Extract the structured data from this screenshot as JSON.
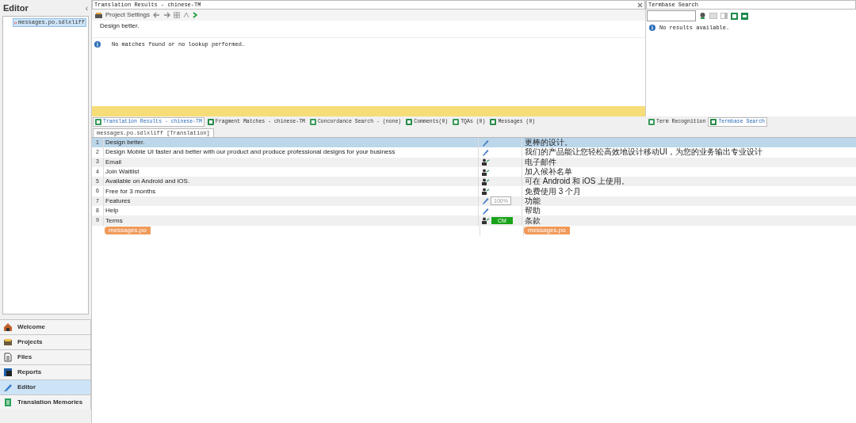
{
  "sidebar": {
    "title": "Editor",
    "collapse": "‹",
    "files": [
      {
        "name": "messages.po.sdlxliff",
        "selected": true
      }
    ],
    "nav": [
      {
        "label": "Welcome",
        "kind": "home",
        "selected": false
      },
      {
        "label": "Projects",
        "kind": "folder",
        "selected": false
      },
      {
        "label": "Files",
        "kind": "file",
        "selected": false
      },
      {
        "label": "Reports",
        "kind": "report",
        "selected": false
      },
      {
        "label": "Editor",
        "kind": "pencil",
        "selected": true
      },
      {
        "label": "Translation Memories",
        "kind": "tm",
        "selected": false
      }
    ]
  },
  "results_panel": {
    "title": "Translation Results - chinese-TM",
    "toolbar_label": "Project Settings",
    "source": "Design better.",
    "message": "No matches found or no lookup performed."
  },
  "termbase_panel": {
    "title": "Termbase Search",
    "message": "No results available."
  },
  "bottom_tabs": [
    {
      "label": "Translation Results - chinese-TM",
      "selected": true
    },
    {
      "label": "Fragment Matches - chinese-TM",
      "selected": false
    },
    {
      "label": "Concordance Search - (none)",
      "selected": false
    },
    {
      "label": "Comments(0)",
      "selected": false
    },
    {
      "label": "TQAs (0)",
      "selected": false
    },
    {
      "label": "Messages (0)",
      "selected": false
    }
  ],
  "right_tabs": [
    {
      "label": "Term Recognition",
      "selected": false
    },
    {
      "label": "Termbase Search",
      "selected": true
    }
  ],
  "document_tab": "messages.po.sdlxliff [Translation]",
  "segments": [
    {
      "number": "1",
      "source": "Design better.",
      "kind": "edited",
      "target": "更棒的设计。",
      "selected": true
    },
    {
      "number": "2",
      "source": "Design Mobile UI faster and better with our product and produce professional designs for your business",
      "kind": "edited",
      "target": "我们的产品能让您轻松高效地设计移动UI，为您的业务输出专业设计",
      "selected": false
    },
    {
      "number": "3",
      "source": "Email",
      "kind": "translated",
      "target": "电子邮件",
      "selected": false
    },
    {
      "number": "4",
      "source": "Join Waitlist",
      "kind": "translated",
      "target": "加入候补名单",
      "selected": false
    },
    {
      "number": "5",
      "source": "Available on Android and iOS.",
      "kind": "translated",
      "target": "可在 Android 和 iOS 上使用。",
      "selected": false
    },
    {
      "number": "6",
      "source": "Free for 3 months",
      "kind": "translated",
      "target": "免费使用 3 个月",
      "selected": false
    },
    {
      "number": "7",
      "source": "Features",
      "kind": "edited",
      "match": "100%",
      "target": "功能",
      "selected": false
    },
    {
      "number": "8",
      "source": "Help",
      "kind": "edited",
      "target": "帮助",
      "selected": false
    },
    {
      "number": "9",
      "source": "Terms",
      "kind": "translated",
      "match": "CM",
      "target": "条款",
      "selected": false
    }
  ],
  "source_file_tag": "messages.po",
  "target_file_tag": "messages.po"
}
